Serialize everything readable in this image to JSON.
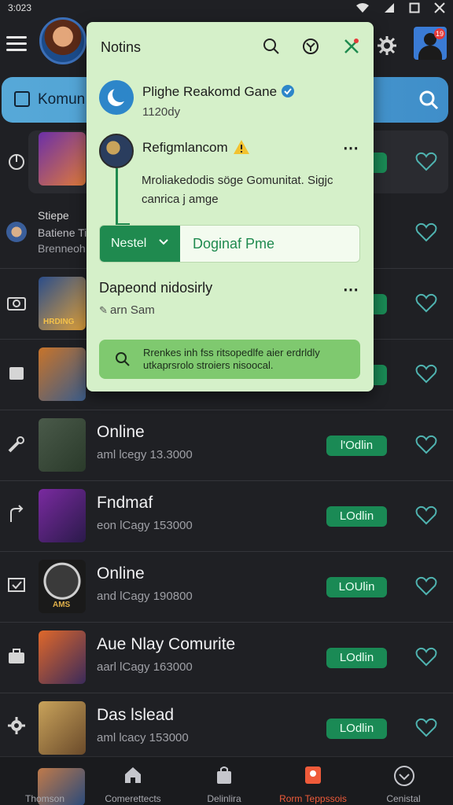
{
  "status": {
    "time": "3:023"
  },
  "header": {
    "search_label": "Komun",
    "notification_count": "19"
  },
  "popup": {
    "title": "Notins",
    "n1": {
      "title": "Plighe Reakomd Gane",
      "sub": "1120dy"
    },
    "n2": {
      "title": "Refigmlancom",
      "body": "Mroliakedodis söge Gomunitat. Sigjc canrica j amge"
    },
    "action": {
      "select": "Nestel",
      "label": "Doginaf Pme"
    },
    "n3": {
      "title": "Dapeond nidosirly",
      "sub": "arn Sam"
    },
    "hint": "Rrenkes inh fss ritsopedlfe aier erdrldly utkaprsrolo stroiers nisoocal."
  },
  "rows": [
    {
      "title": "",
      "sub": "",
      "pill": ""
    },
    {
      "title": "Stiepe",
      "sub": "Batiene Ti",
      "sub2": "Brenneoh",
      "pill": ""
    },
    {
      "title": "",
      "sub": "",
      "pill": ""
    },
    {
      "title": "",
      "sub": "",
      "pill": ""
    },
    {
      "title": "Online",
      "sub": "aml lcegy 13.3000",
      "pill": "l'Odlin"
    },
    {
      "title": "Fndmaf",
      "sub": "eon lCagy 153000",
      "pill": "LOdlin"
    },
    {
      "title": "Online",
      "sub": "and lCagy 190800",
      "pill": "LOUlin"
    },
    {
      "title": "Aue Nlay Comurite",
      "sub": "aarl lCagy 163000",
      "pill": "LOdlin"
    },
    {
      "title": "Das lslead",
      "sub": "aml lcacy 153000",
      "pill": "LOdlin"
    }
  ],
  "thumb_text": {
    "row3": "HRDING",
    "row7": "AMS"
  },
  "nav": [
    {
      "label": "Thomson",
      "icon": "game-icon"
    },
    {
      "label": "Comerettects",
      "icon": "home-icon"
    },
    {
      "label": "Delinlira",
      "icon": "store-icon"
    },
    {
      "label": "Rorm Teppssois",
      "icon": "trophy-icon"
    },
    {
      "label": "Cenistal",
      "icon": "chevron-circle-icon"
    }
  ],
  "colors": {
    "accent": "#1f8a4f",
    "active_nav": "#ef5b3a",
    "search_bar": "#4a9dd2",
    "popup_bg": "#d5f0c9"
  }
}
